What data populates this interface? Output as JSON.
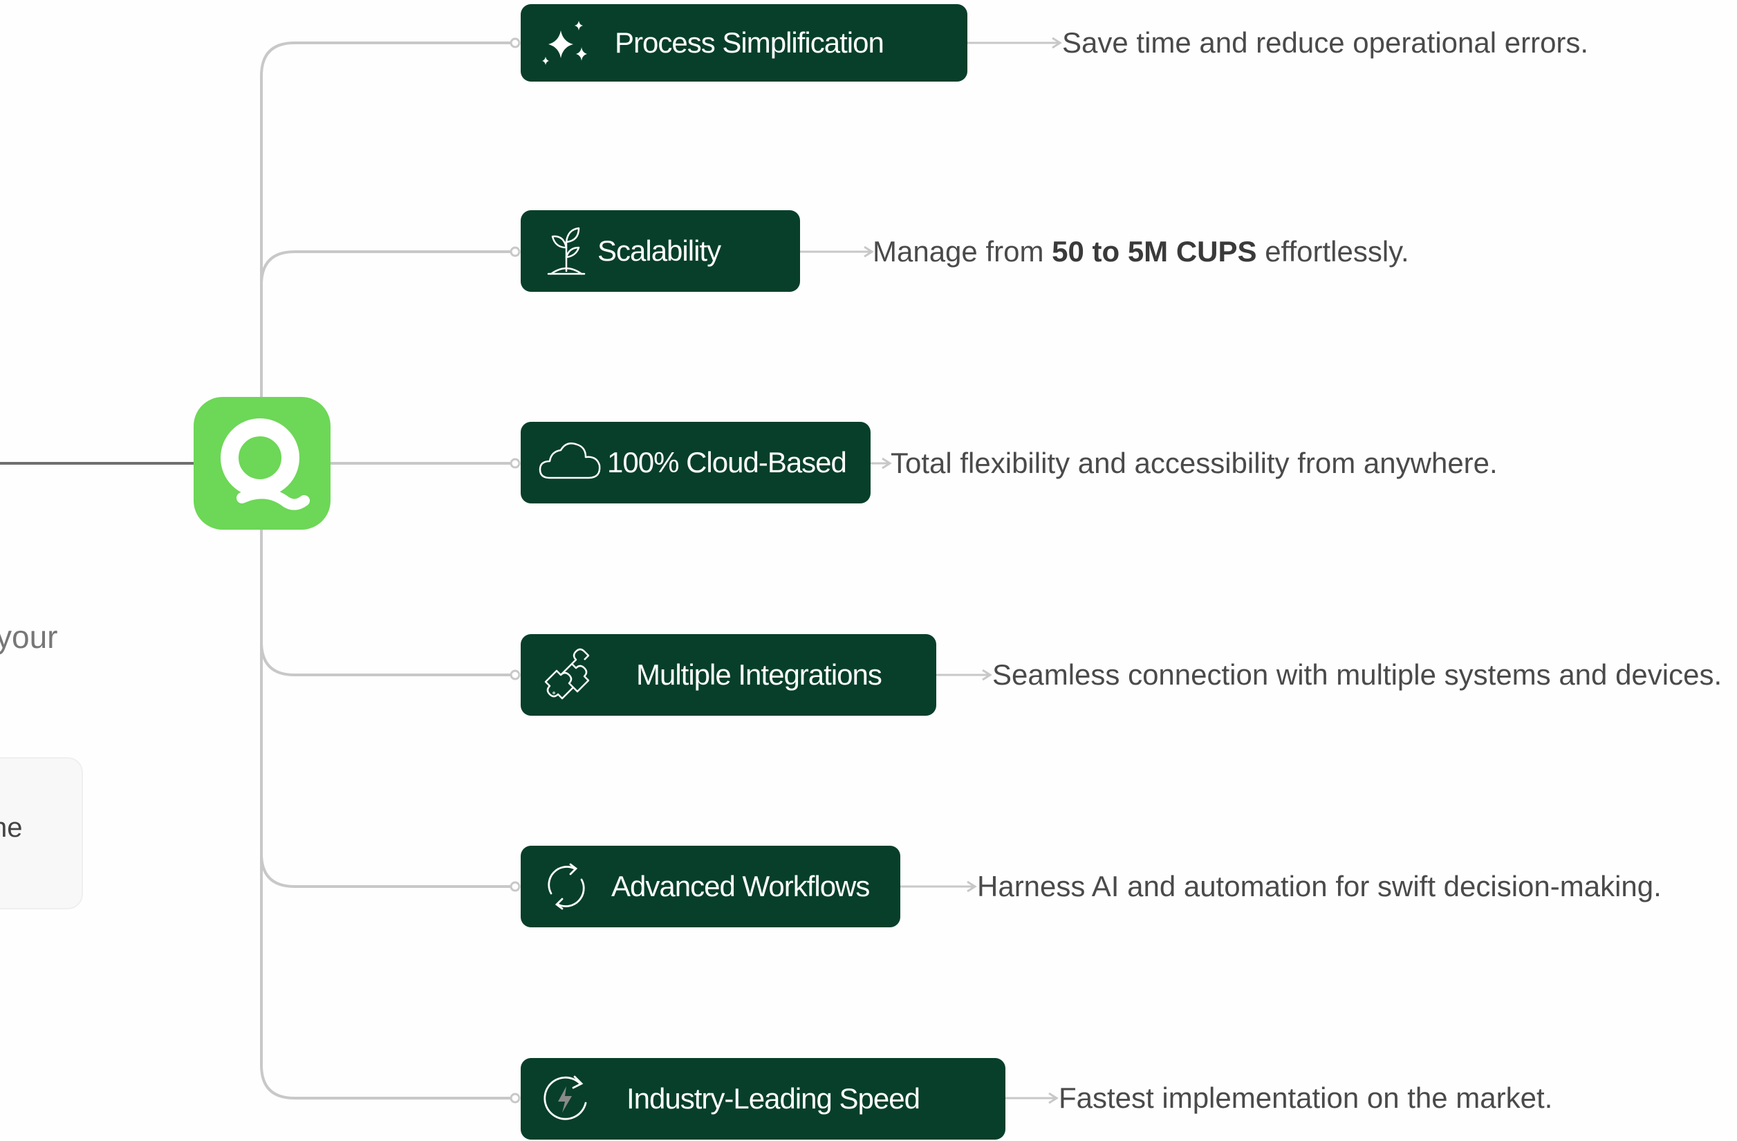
{
  "hub": {
    "icon": "q-logo-icon"
  },
  "left_text_fragment": "your",
  "left_card_fragment": "ne",
  "features": [
    {
      "label": "Process Simplification",
      "icon": "sparkles-icon",
      "description": "Save time and reduce operational errors."
    },
    {
      "label": "Scalability",
      "icon": "sprout-icon",
      "description_pre": "Manage from ",
      "description_bold": "50 to 5M CUPS",
      "description_post": " effortlessly."
    },
    {
      "label": "100% Cloud-Based",
      "icon": "cloud-icon",
      "description": "Total flexibility and accessibility from anywhere."
    },
    {
      "label": "Multiple Integrations",
      "icon": "puzzle-icon",
      "description": "Seamless connection with multiple systems and devices."
    },
    {
      "label": "Advanced Workflows",
      "icon": "refresh-icon",
      "description": "Harness AI and automation for swift decision-making."
    },
    {
      "label": "Industry-Leading Speed",
      "icon": "lightning-refresh-icon",
      "description": "Fastest implementation on the market."
    }
  ],
  "colors": {
    "pill": "#073f2a",
    "hub": "#6dd757",
    "line": "#c8c8c8",
    "text": "#4a4a4a"
  }
}
